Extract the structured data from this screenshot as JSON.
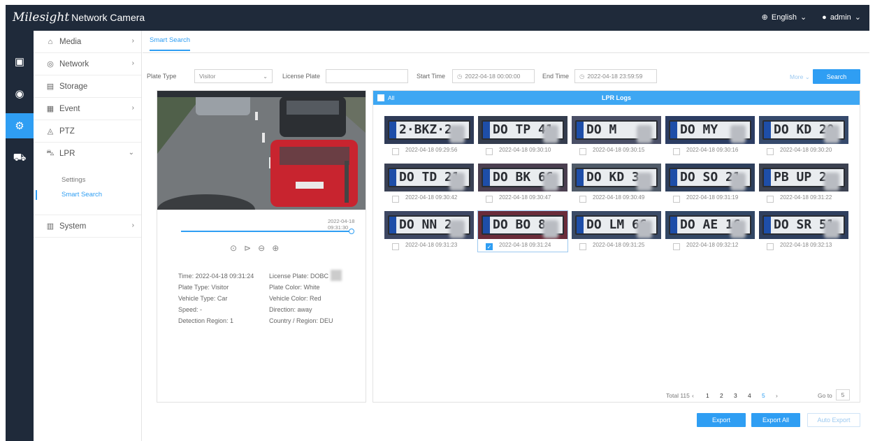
{
  "app": {
    "brand": "Milesight",
    "product": "Network Camera",
    "language": "English",
    "user": "admin"
  },
  "menu": {
    "media": "Media",
    "network": "Network",
    "storage": "Storage",
    "event": "Event",
    "ptz": "PTZ",
    "lpr": "LPR",
    "lpr_settings": "Settings",
    "lpr_smart_search": "Smart Search",
    "system": "System"
  },
  "tab": "Smart Search",
  "filters": {
    "plate_type_label": "Plate Type",
    "plate_type_value": "Visitor",
    "license_plate_label": "License Plate",
    "license_plate_value": "",
    "start_time_label": "Start Time",
    "start_time_value": "2022-04-18 00:00:00",
    "end_time_label": "End Time",
    "end_time_value": "2022-04-18 23:59:59",
    "more": "More",
    "search": "Search"
  },
  "player": {
    "timestamp": "2022-04-18 09:31:30",
    "progress": 1.0
  },
  "details": {
    "time": "Time: 2022-04-18 09:31:24",
    "license_plate": "License Plate: DOBC",
    "plate_type": "Plate Type: Visitor",
    "plate_color": "Plate Color: White",
    "vehicle_type": "Vehicle Type: Car",
    "vehicle_color": "Vehicle Color: Red",
    "speed": "Speed: -",
    "direction": "Direction: away",
    "detection_region": "Detection Region: 1",
    "country_region": "Country / Region: DEU"
  },
  "logs": {
    "title": "LPR Logs",
    "all_label": "All",
    "items": [
      {
        "plate": "2·BKZ·2",
        "time": "2022-04-18 09:29:56",
        "checked": false
      },
      {
        "plate": "DO TP 41",
        "time": "2022-04-18 09:30:10",
        "checked": false
      },
      {
        "plate": "DO M",
        "time": "2022-04-18 09:30:15",
        "checked": false
      },
      {
        "plate": "DO MY",
        "time": "2022-04-18 09:30:16",
        "checked": false
      },
      {
        "plate": "DO KD 20",
        "time": "2022-04-18 09:30:20",
        "checked": false
      },
      {
        "plate": "DO TD 21",
        "time": "2022-04-18 09:30:42",
        "checked": false
      },
      {
        "plate": "DO BK 66",
        "time": "2022-04-18 09:30:47",
        "checked": false
      },
      {
        "plate": "DO KD 3",
        "time": "2022-04-18 09:30:49",
        "checked": false
      },
      {
        "plate": "DO SO 21",
        "time": "2022-04-18 09:31:19",
        "checked": false
      },
      {
        "plate": "PB UP 2",
        "time": "2022-04-18 09:31:22",
        "checked": false
      },
      {
        "plate": "DO NN 2",
        "time": "2022-04-18 09:31:23",
        "checked": false
      },
      {
        "plate": "DO BO 8",
        "time": "2022-04-18 09:31:24",
        "checked": true
      },
      {
        "plate": "DO LM 66",
        "time": "2022-04-18 09:31:25",
        "checked": false
      },
      {
        "plate": "DO AE 16",
        "time": "2022-04-18 09:32:12",
        "checked": false
      },
      {
        "plate": "DO SR 51",
        "time": "2022-04-18 09:32:13",
        "checked": false
      }
    ]
  },
  "pagination": {
    "total": "Total 115",
    "pages": [
      "1",
      "2",
      "3",
      "4",
      "5"
    ],
    "goto_label": "Go to",
    "goto_value": "5"
  },
  "actions": {
    "export": "Export",
    "export_all": "Export All",
    "auto_export": "Auto Export"
  },
  "colors": {
    "accent": "#2f9ef3",
    "nav": "#1f2a3a",
    "log_header": "#3ea7f3"
  }
}
